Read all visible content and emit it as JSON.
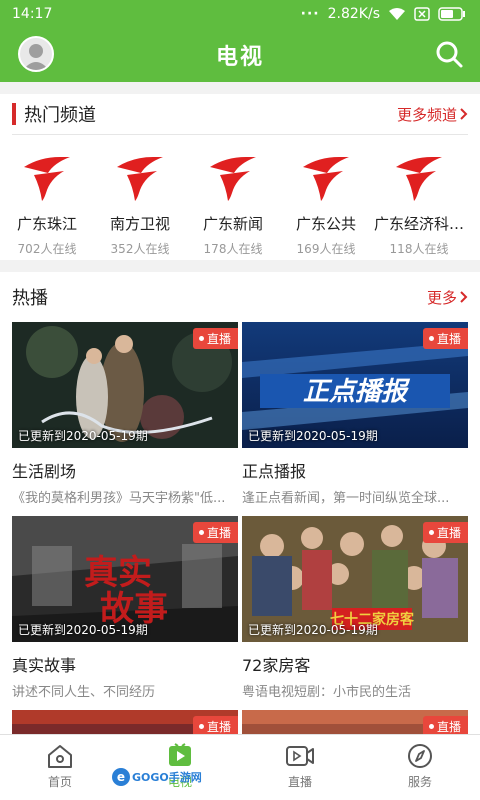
{
  "status_bar": {
    "time": "14:17",
    "speed": "2.82K/s"
  },
  "header": {
    "title": "电视"
  },
  "channels_section": {
    "title": "热门频道",
    "more": "更多频道",
    "channels": [
      {
        "name": "广东珠江",
        "online": "702人在线"
      },
      {
        "name": "南方卫视",
        "online": "352人在线"
      },
      {
        "name": "广东新闻",
        "online": "178人在线"
      },
      {
        "name": "广东公共",
        "online": "169人在线"
      },
      {
        "name": "广东经济科…",
        "online": "118人在线"
      }
    ]
  },
  "hot_section": {
    "title": "热播",
    "more": "更多",
    "live_label": "直播",
    "items": [
      {
        "updated": "已更新到2020-05-19期",
        "title": "生活剧场",
        "desc": "《我的莫格利男孩》马天宇杨紫\"低..."
      },
      {
        "updated": "已更新到2020-05-19期",
        "title": "正点播报",
        "desc": "逢正点看新闻，第一时间纵览全球..."
      },
      {
        "updated": "已更新到2020-05-19期",
        "title": "真实故事",
        "desc": "讲述不同人生、不同经历"
      },
      {
        "updated": "已更新到2020-05-19期",
        "title": "72家房客",
        "desc": "粤语电视短剧：小市民的生活"
      }
    ]
  },
  "bottom_nav": [
    {
      "label": "首页",
      "icon": "home-icon"
    },
    {
      "label": "电视",
      "icon": "tv-play-icon",
      "active": true
    },
    {
      "label": "直播",
      "icon": "live-camera-icon"
    },
    {
      "label": "服务",
      "icon": "compass-icon"
    }
  ],
  "watermark": {
    "text": "GOGO手游网"
  },
  "colors": {
    "brand_green": "#5fbd3f",
    "accent_red": "#d62a2a",
    "live_red": "#e8473c"
  }
}
